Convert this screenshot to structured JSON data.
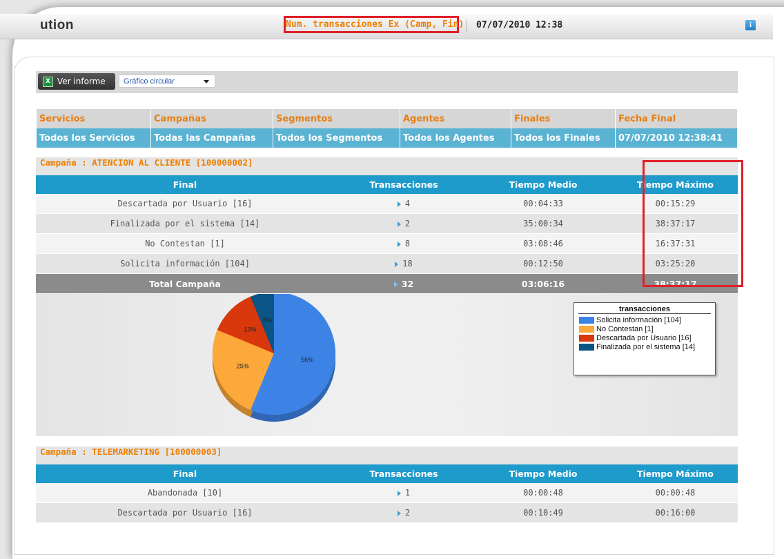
{
  "header": {
    "logo_text": "ution",
    "report_title": "Num. transacciones Ex (Camp, Fin)",
    "datetime": "07/07/2010 12:38",
    "info_icon": "info-icon"
  },
  "toolbar": {
    "ver_informe_label": "Ver informe",
    "excel_icon": "excel-icon",
    "chart_type_selected": "Gráfico circular"
  },
  "filters": {
    "headers": [
      "Servicios",
      "Campañas",
      "Segmentos",
      "Agentes",
      "Finales",
      "Fecha Final"
    ],
    "values": [
      "Todos los Servicios",
      "Todas las Campañas",
      "Todos los Segmentos",
      "Todos los Agentes",
      "Todos los Finales",
      "07/07/2010 12:38:41"
    ]
  },
  "columns": [
    "Final",
    "Transacciones",
    "Tiempo Medio",
    "Tiempo Máximo"
  ],
  "campaigns": [
    {
      "title": "Campaña : ATENCION AL CLIENTE [100000002]",
      "rows": [
        {
          "final": "Descartada por Usuario [16]",
          "transacciones": "4",
          "medio": "00:04:33",
          "maximo": "00:15:29"
        },
        {
          "final": "Finalizada por el sistema [14]",
          "transacciones": "2",
          "medio": "35:00:34",
          "maximo": "38:37:17"
        },
        {
          "final": "No Contestan [1]",
          "transacciones": "8",
          "medio": "03:08:46",
          "maximo": "16:37:31"
        },
        {
          "final": "Solicita información [104]",
          "transacciones": "18",
          "medio": "00:12:50",
          "maximo": "03:25:20"
        }
      ],
      "total": {
        "label": "Total Campaña",
        "transacciones": "32",
        "medio": "03:06:16",
        "maximo": "38:37:17"
      }
    },
    {
      "title": "Campaña : TELEMARKETING [100000003]",
      "rows": [
        {
          "final": "Abandonada [10]",
          "transacciones": "1",
          "medio": "00:00:48",
          "maximo": "00:00:48"
        },
        {
          "final": "Descartada por Usuario [16]",
          "transacciones": "2",
          "medio": "00:10:49",
          "maximo": "00:16:00"
        }
      ]
    }
  ],
  "chart_data": {
    "type": "pie",
    "title": "transacciones",
    "labels": [
      "Solicita información [104]",
      "No Contestan [1]",
      "Descartada por Usuario [16]",
      "Finalizada por el sistema [14]"
    ],
    "values": [
      18,
      8,
      4,
      2
    ],
    "percent_labels": [
      "56%",
      "25%",
      "13%",
      "6%"
    ],
    "colors": [
      "#3d83e6",
      "#fca83a",
      "#d8380b",
      "#0b5486"
    ],
    "legend_position": "right"
  }
}
